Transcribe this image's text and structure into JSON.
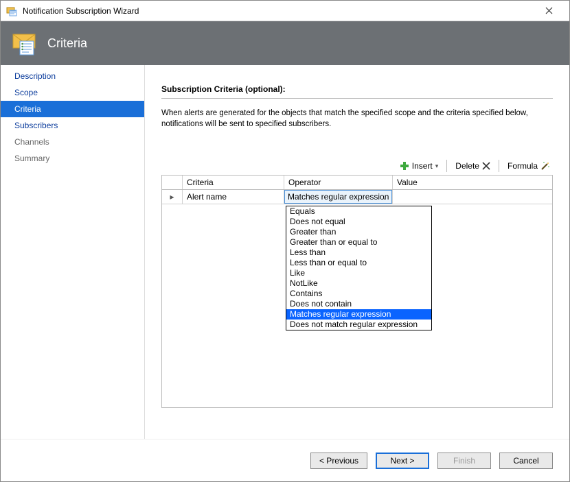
{
  "window": {
    "title": "Notification Subscription Wizard"
  },
  "header": {
    "title": "Criteria"
  },
  "sidebar": {
    "items": [
      {
        "label": "Description",
        "active": false,
        "muted": false
      },
      {
        "label": "Scope",
        "active": false,
        "muted": false
      },
      {
        "label": "Criteria",
        "active": true,
        "muted": false
      },
      {
        "label": "Subscribers",
        "active": false,
        "muted": false
      },
      {
        "label": "Channels",
        "active": false,
        "muted": true
      },
      {
        "label": "Summary",
        "active": false,
        "muted": true
      }
    ]
  },
  "section": {
    "title": "Subscription Criteria (optional):",
    "description": "When alerts are generated for the objects that match the specified scope and the criteria specified below, notifications will be sent to specified subscribers."
  },
  "toolbar": {
    "insert": "Insert",
    "delete": "Delete",
    "formula": "Formula"
  },
  "grid": {
    "headers": {
      "criteria": "Criteria",
      "operator": "Operator",
      "value": "Value"
    },
    "rows": [
      {
        "criteria": "Alert name",
        "operator": "Matches regular expression",
        "value": ""
      }
    ]
  },
  "operator_options": [
    "Equals",
    "Does not equal",
    "Greater than",
    "Greater than or equal to",
    "Less than",
    "Less than or equal to",
    "Like",
    "NotLike",
    "Contains",
    "Does not contain",
    "Matches regular expression",
    "Does not match regular expression"
  ],
  "operator_selected": "Matches regular expression",
  "footer": {
    "previous": "< Previous",
    "next": "Next >",
    "finish": "Finish",
    "cancel": "Cancel"
  }
}
